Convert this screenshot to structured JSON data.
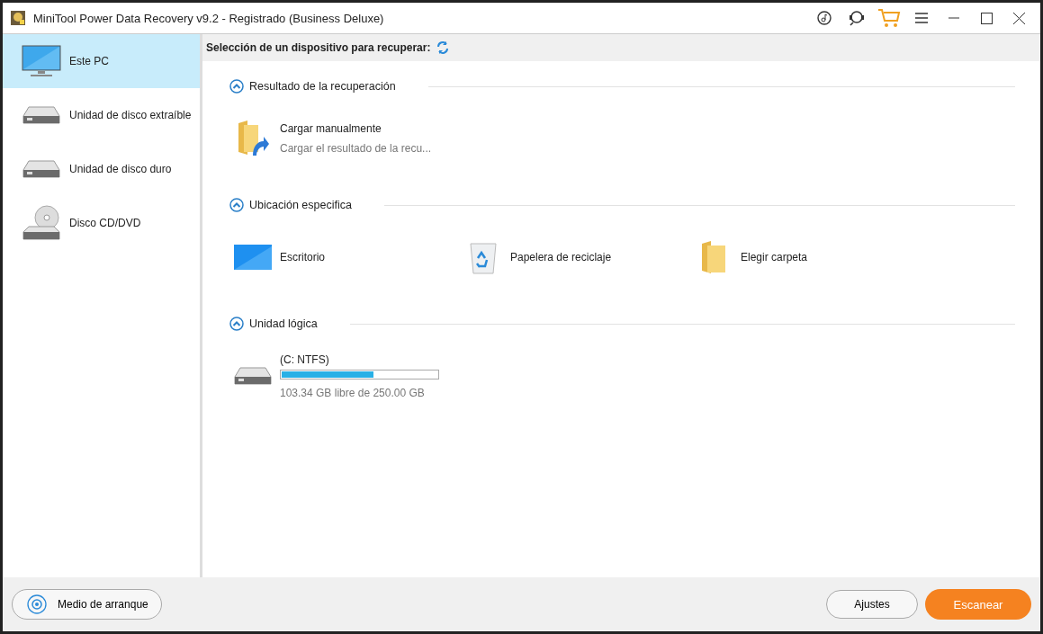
{
  "window": {
    "title": "MiniTool Power Data Recovery v9.2 - Registrado (Business Deluxe)"
  },
  "sidebar": {
    "items": [
      {
        "kind": "pc",
        "label": "Este PC",
        "selected": true
      },
      {
        "kind": "removable",
        "label": "Unidad de disco extraíble",
        "selected": false
      },
      {
        "kind": "hdd",
        "label": "Unidad de disco duro",
        "selected": false
      },
      {
        "kind": "cd",
        "label": "Disco CD/DVD",
        "selected": false
      }
    ]
  },
  "header": {
    "title": "Selección de un dispositivo para recuperar:"
  },
  "sections": [
    {
      "title": "Resultado de la recuperación",
      "expanded": true,
      "items": [
        {
          "kind": "load",
          "label": "Cargar manualmente",
          "subtitle": "Cargar el resultado de la recu..."
        }
      ]
    },
    {
      "title": "Ubicación especifica",
      "expanded": true,
      "items": [
        {
          "kind": "desktop",
          "label": "Escritorio"
        },
        {
          "kind": "recycle",
          "label": "Papelera de reciclaje"
        },
        {
          "kind": "folder",
          "label": "Elegir carpeta"
        }
      ]
    },
    {
      "title": "Unidad lógica",
      "expanded": true,
      "items": [
        {
          "kind": "drive",
          "label": "(C: NTFS)",
          "level": 0.59,
          "subtitle": "103.34 GB libre de 250.00 GB"
        }
      ]
    }
  ],
  "footer": {
    "boot_button": "Medio de arranque",
    "settings_button": "Ajustes",
    "scan_button": "Escanear"
  }
}
